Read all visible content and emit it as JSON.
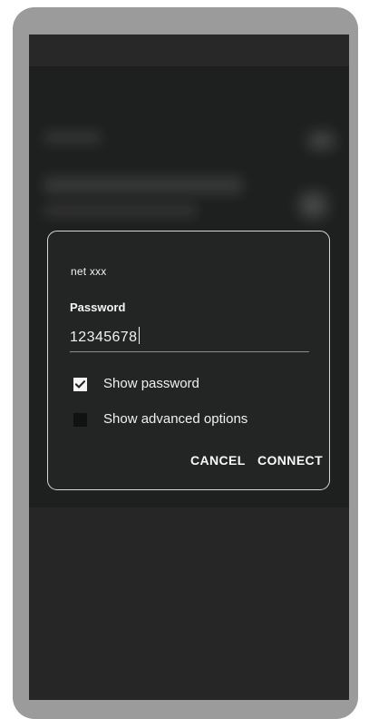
{
  "dialog": {
    "network_name": "net  xxx",
    "password_label": "Password",
    "password_value": "12345678",
    "show_password": {
      "label": "Show password",
      "checked": true
    },
    "show_advanced": {
      "label": "Show advanced options",
      "checked": false
    },
    "actions": {
      "cancel": "CANCEL",
      "connect": "CONNECT"
    }
  },
  "icons": {
    "checkbox_checked": "check-icon"
  },
  "colors": {
    "device_frame": "#9b9b9b",
    "screen_background": "#262626",
    "dialog_background": "#232525",
    "dialog_border": "#d5d7d9",
    "text": "#f4f4f4"
  }
}
